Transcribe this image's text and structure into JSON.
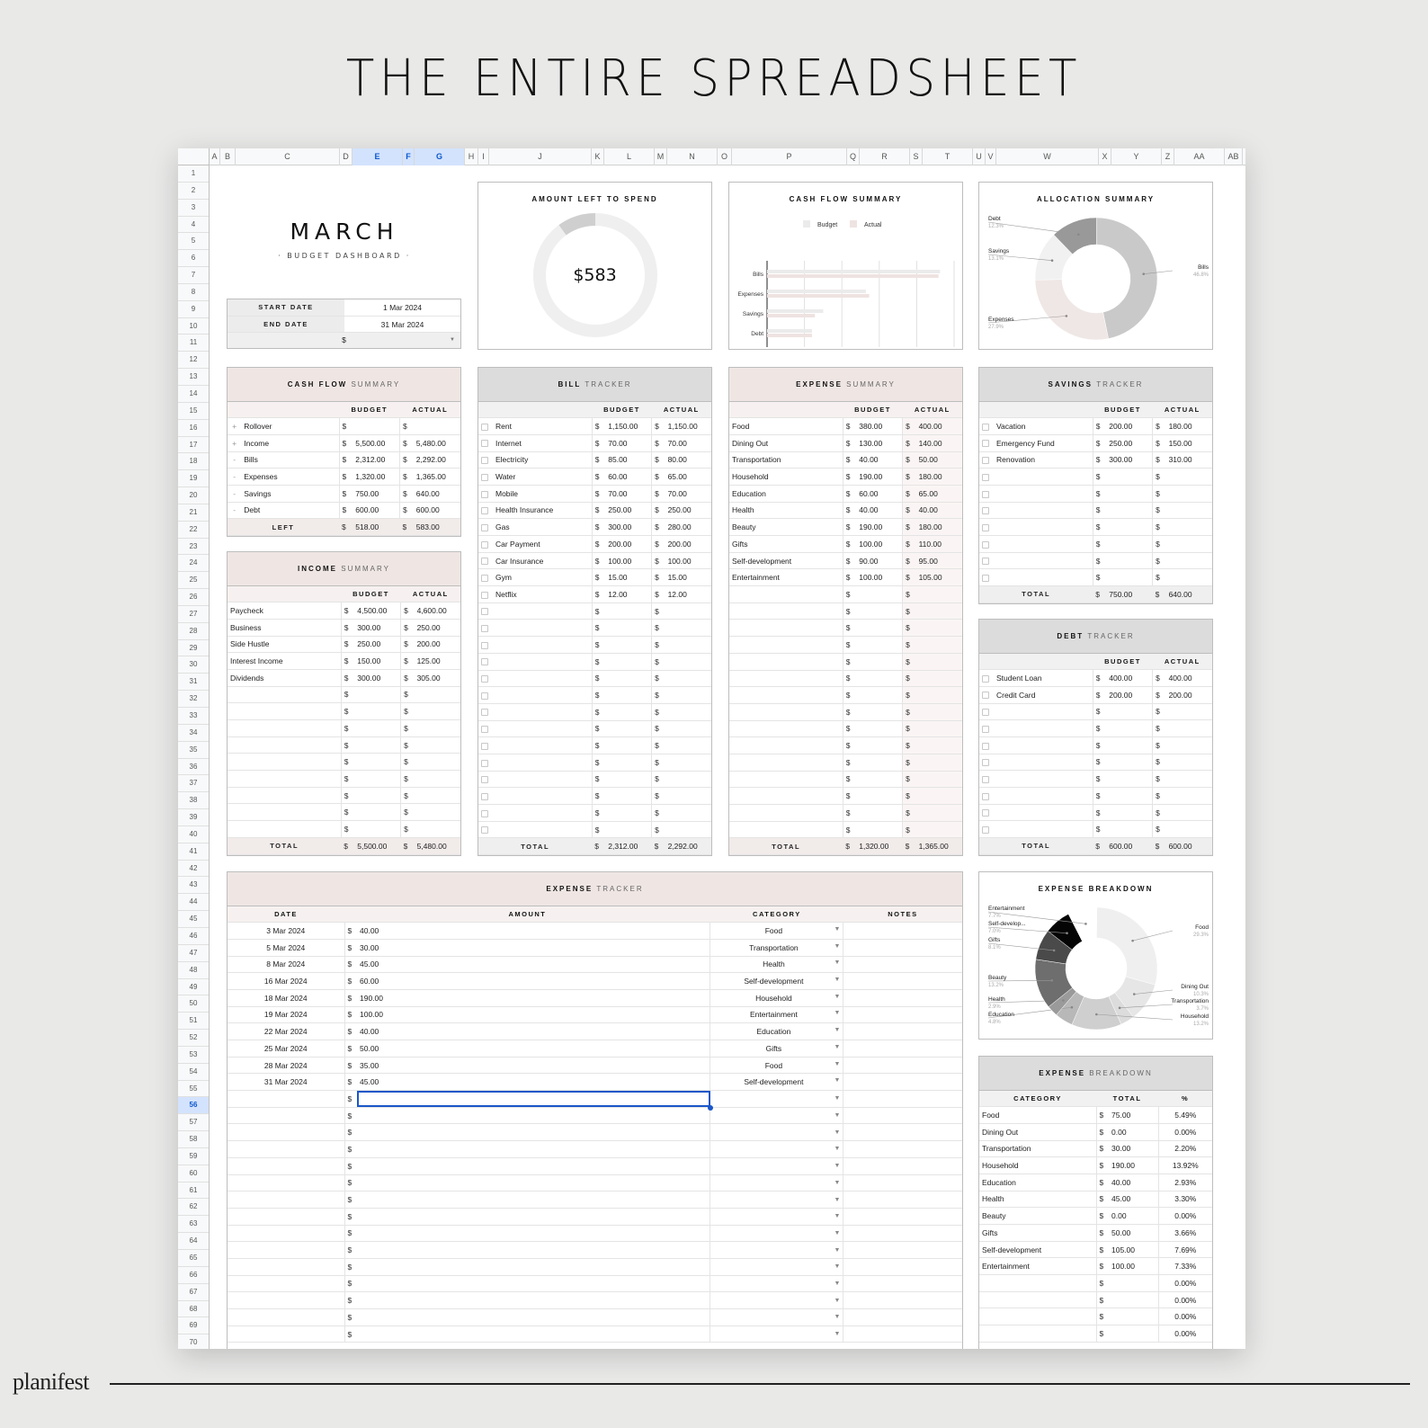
{
  "hero_title": "THE ENTIRE SPREADSHEET",
  "brand": "planifest",
  "columns": [
    "A",
    "B",
    "C",
    "D",
    "E",
    "F",
    "G",
    "H",
    "I",
    "J",
    "K",
    "L",
    "M",
    "N",
    "O",
    "P",
    "Q",
    "R",
    "S",
    "T",
    "U",
    "V",
    "W",
    "X",
    "Y",
    "Z",
    "AA",
    "AB"
  ],
  "selected_columns": [
    "E",
    "F",
    "G"
  ],
  "selected_row": 56,
  "dashboard": {
    "month": "MARCH",
    "subtitle": "· BUDGET DASHBOARD ·",
    "start_date_label": "START DATE",
    "start_date": "1 Mar 2024",
    "end_date_label": "END DATE",
    "end_date": "31 Mar 2024",
    "currency": "$"
  },
  "amount_left": {
    "title": "AMOUNT LEFT TO SPEND",
    "value": "$583",
    "fraction_spent_shown": 0.1
  },
  "chart_data": [
    {
      "type": "bar",
      "title": "CASH FLOW SUMMARY",
      "orientation": "horizontal",
      "categories": [
        "Bills",
        "Expenses",
        "Savings",
        "Debt"
      ],
      "series": [
        {
          "name": "Budget",
          "values": [
            2312,
            1320,
            750,
            600
          ],
          "color": "#ebebeb"
        },
        {
          "name": "Actual",
          "values": [
            2292,
            1365,
            640,
            600
          ],
          "color": "#eee3e1"
        }
      ],
      "xlim": [
        0,
        2500
      ],
      "grid": true,
      "legend": "top"
    },
    {
      "type": "pie",
      "title": "ALLOCATION SUMMARY",
      "donut": true,
      "slices": [
        {
          "label": "Bills",
          "percent": 46.8,
          "color": "#c9c9c9"
        },
        {
          "label": "Expenses",
          "percent": 27.9,
          "color": "#efe7e5"
        },
        {
          "label": "Savings",
          "percent": 13.1,
          "color": "#f1f1f1"
        },
        {
          "label": "Debt",
          "percent": 12.3,
          "color": "#999999"
        }
      ]
    },
    {
      "type": "pie",
      "title": "EXPENSE BREAKDOWN",
      "donut": true,
      "slices": [
        {
          "label": "Food",
          "percent": 29.3,
          "color": "#efefef"
        },
        {
          "label": "Dining Out",
          "percent": 10.3,
          "color": "#e6e6e6"
        },
        {
          "label": "Transportation",
          "percent": 3.7,
          "color": "#dcdcdc"
        },
        {
          "label": "Household",
          "percent": 13.2,
          "color": "#cfcfcf"
        },
        {
          "label": "Education",
          "percent": 4.8,
          "color": "#b8b8b8"
        },
        {
          "label": "Health",
          "percent": 2.9,
          "color": "#9a9a9a"
        },
        {
          "label": "Beauty",
          "percent": 13.2,
          "color": "#6e6e6e"
        },
        {
          "label": "Gifts",
          "percent": 8.1,
          "color": "#4a4a4a"
        },
        {
          "label": "Self-develop...",
          "percent": 7.0,
          "color": "#050505"
        },
        {
          "label": "Entertainment",
          "percent": 7.7,
          "color": "#ffffff"
        }
      ]
    }
  ],
  "cash_flow": {
    "title_bold": "CASH FLOW",
    "title_light": "SUMMARY",
    "headers": [
      "BUDGET",
      "ACTUAL"
    ],
    "rows": [
      {
        "sign": "+",
        "label": "Rollover",
        "budget": "",
        "actual": ""
      },
      {
        "sign": "+",
        "label": "Income",
        "budget": "5,500.00",
        "actual": "5,480.00"
      },
      {
        "sign": "-",
        "label": "Bills",
        "budget": "2,312.00",
        "actual": "2,292.00"
      },
      {
        "sign": "-",
        "label": "Expenses",
        "budget": "1,320.00",
        "actual": "1,365.00"
      },
      {
        "sign": "-",
        "label": "Savings",
        "budget": "750.00",
        "actual": "640.00"
      },
      {
        "sign": "-",
        "label": "Debt",
        "budget": "600.00",
        "actual": "600.00"
      }
    ],
    "footer_label": "LEFT",
    "footer_budget": "518.00",
    "footer_actual": "583.00"
  },
  "income": {
    "title_bold": "INCOME",
    "title_light": "SUMMARY",
    "headers": [
      "BUDGET",
      "ACTUAL"
    ],
    "rows": [
      {
        "label": "Paycheck",
        "budget": "4,500.00",
        "actual": "4,600.00"
      },
      {
        "label": "Business",
        "budget": "300.00",
        "actual": "250.00"
      },
      {
        "label": "Side Hustle",
        "budget": "250.00",
        "actual": "200.00"
      },
      {
        "label": "Interest Income",
        "budget": "150.00",
        "actual": "125.00"
      },
      {
        "label": "Dividends",
        "budget": "300.00",
        "actual": "305.00"
      },
      {
        "label": "",
        "budget": "",
        "actual": ""
      },
      {
        "label": "",
        "budget": "",
        "actual": ""
      },
      {
        "label": "",
        "budget": "",
        "actual": ""
      },
      {
        "label": "",
        "budget": "",
        "actual": ""
      },
      {
        "label": "",
        "budget": "",
        "actual": ""
      },
      {
        "label": "",
        "budget": "",
        "actual": ""
      },
      {
        "label": "",
        "budget": "",
        "actual": ""
      },
      {
        "label": "",
        "budget": "",
        "actual": ""
      },
      {
        "label": "",
        "budget": "",
        "actual": ""
      }
    ],
    "footer_label": "TOTAL",
    "footer_budget": "5,500.00",
    "footer_actual": "5,480.00"
  },
  "bills": {
    "title_bold": "BILL",
    "title_light": "TRACKER",
    "headers": [
      "BUDGET",
      "ACTUAL"
    ],
    "rows": [
      {
        "label": "Rent",
        "budget": "1,150.00",
        "actual": "1,150.00"
      },
      {
        "label": "Internet",
        "budget": "70.00",
        "actual": "70.00"
      },
      {
        "label": "Electricity",
        "budget": "85.00",
        "actual": "80.00"
      },
      {
        "label": "Water",
        "budget": "60.00",
        "actual": "65.00"
      },
      {
        "label": "Mobile",
        "budget": "70.00",
        "actual": "70.00"
      },
      {
        "label": "Health Insurance",
        "budget": "250.00",
        "actual": "250.00"
      },
      {
        "label": "Gas",
        "budget": "300.00",
        "actual": "280.00"
      },
      {
        "label": "Car Payment",
        "budget": "200.00",
        "actual": "200.00"
      },
      {
        "label": "Car Insurance",
        "budget": "100.00",
        "actual": "100.00"
      },
      {
        "label": "Gym",
        "budget": "15.00",
        "actual": "15.00"
      },
      {
        "label": "Netflix",
        "budget": "12.00",
        "actual": "12.00"
      },
      {
        "label": "",
        "budget": "",
        "actual": ""
      },
      {
        "label": "",
        "budget": "",
        "actual": ""
      },
      {
        "label": "",
        "budget": "",
        "actual": ""
      },
      {
        "label": "",
        "budget": "",
        "actual": ""
      },
      {
        "label": "",
        "budget": "",
        "actual": ""
      },
      {
        "label": "",
        "budget": "",
        "actual": ""
      },
      {
        "label": "",
        "budget": "",
        "actual": ""
      },
      {
        "label": "",
        "budget": "",
        "actual": ""
      },
      {
        "label": "",
        "budget": "",
        "actual": ""
      },
      {
        "label": "",
        "budget": "",
        "actual": ""
      },
      {
        "label": "",
        "budget": "",
        "actual": ""
      },
      {
        "label": "",
        "budget": "",
        "actual": ""
      },
      {
        "label": "",
        "budget": "",
        "actual": ""
      },
      {
        "label": "",
        "budget": "",
        "actual": ""
      }
    ],
    "footer_label": "TOTAL",
    "footer_budget": "2,312.00",
    "footer_actual": "2,292.00"
  },
  "expense_summary": {
    "title_bold": "EXPENSE",
    "title_light": "SUMMARY",
    "headers": [
      "BUDGET",
      "ACTUAL"
    ],
    "rows": [
      {
        "label": "Food",
        "budget": "380.00",
        "actual": "400.00"
      },
      {
        "label": "Dining Out",
        "budget": "130.00",
        "actual": "140.00"
      },
      {
        "label": "Transportation",
        "budget": "40.00",
        "actual": "50.00"
      },
      {
        "label": "Household",
        "budget": "190.00",
        "actual": "180.00"
      },
      {
        "label": "Education",
        "budget": "60.00",
        "actual": "65.00"
      },
      {
        "label": "Health",
        "budget": "40.00",
        "actual": "40.00"
      },
      {
        "label": "Beauty",
        "budget": "190.00",
        "actual": "180.00"
      },
      {
        "label": "Gifts",
        "budget": "100.00",
        "actual": "110.00"
      },
      {
        "label": "Self-development",
        "budget": "90.00",
        "actual": "95.00"
      },
      {
        "label": "Entertainment",
        "budget": "100.00",
        "actual": "105.00"
      },
      {
        "label": "",
        "budget": "",
        "actual": ""
      },
      {
        "label": "",
        "budget": "",
        "actual": ""
      },
      {
        "label": "",
        "budget": "",
        "actual": ""
      },
      {
        "label": "",
        "budget": "",
        "actual": ""
      },
      {
        "label": "",
        "budget": "",
        "actual": ""
      },
      {
        "label": "",
        "budget": "",
        "actual": ""
      },
      {
        "label": "",
        "budget": "",
        "actual": ""
      },
      {
        "label": "",
        "budget": "",
        "actual": ""
      },
      {
        "label": "",
        "budget": "",
        "actual": ""
      },
      {
        "label": "",
        "budget": "",
        "actual": ""
      },
      {
        "label": "",
        "budget": "",
        "actual": ""
      },
      {
        "label": "",
        "budget": "",
        "actual": ""
      },
      {
        "label": "",
        "budget": "",
        "actual": ""
      },
      {
        "label": "",
        "budget": "",
        "actual": ""
      },
      {
        "label": "",
        "budget": "",
        "actual": ""
      }
    ],
    "footer_label": "TOTAL",
    "footer_budget": "1,320.00",
    "footer_actual": "1,365.00"
  },
  "savings": {
    "title_bold": "SAVINGS",
    "title_light": "TRACKER",
    "headers": [
      "BUDGET",
      "ACTUAL"
    ],
    "rows": [
      {
        "label": "Vacation",
        "budget": "200.00",
        "actual": "180.00"
      },
      {
        "label": "Emergency Fund",
        "budget": "250.00",
        "actual": "150.00"
      },
      {
        "label": "Renovation",
        "budget": "300.00",
        "actual": "310.00"
      },
      {
        "label": "",
        "budget": "",
        "actual": ""
      },
      {
        "label": "",
        "budget": "",
        "actual": ""
      },
      {
        "label": "",
        "budget": "",
        "actual": ""
      },
      {
        "label": "",
        "budget": "",
        "actual": ""
      },
      {
        "label": "",
        "budget": "",
        "actual": ""
      },
      {
        "label": "",
        "budget": "",
        "actual": ""
      },
      {
        "label": "",
        "budget": "",
        "actual": ""
      }
    ],
    "footer_label": "TOTAL",
    "footer_budget": "750.00",
    "footer_actual": "640.00"
  },
  "debt": {
    "title_bold": "DEBT",
    "title_light": "TRACKER",
    "headers": [
      "BUDGET",
      "ACTUAL"
    ],
    "rows": [
      {
        "label": "Student Loan",
        "budget": "400.00",
        "actual": "400.00"
      },
      {
        "label": "Credit Card",
        "budget": "200.00",
        "actual": "200.00"
      },
      {
        "label": "",
        "budget": "",
        "actual": ""
      },
      {
        "label": "",
        "budget": "",
        "actual": ""
      },
      {
        "label": "",
        "budget": "",
        "actual": ""
      },
      {
        "label": "",
        "budget": "",
        "actual": ""
      },
      {
        "label": "",
        "budget": "",
        "actual": ""
      },
      {
        "label": "",
        "budget": "",
        "actual": ""
      },
      {
        "label": "",
        "budget": "",
        "actual": ""
      },
      {
        "label": "",
        "budget": "",
        "actual": ""
      }
    ],
    "footer_label": "TOTAL",
    "footer_budget": "600.00",
    "footer_actual": "600.00"
  },
  "expense_tracker": {
    "title_bold": "EXPENSE",
    "title_light": "TRACKER",
    "headers": [
      "DATE",
      "AMOUNT",
      "CATEGORY",
      "NOTES"
    ],
    "rows": [
      {
        "date": "3 Mar 2024",
        "amount": "40.00",
        "category": "Food",
        "notes": ""
      },
      {
        "date": "5 Mar 2024",
        "amount": "30.00",
        "category": "Transportation",
        "notes": ""
      },
      {
        "date": "8 Mar 2024",
        "amount": "45.00",
        "category": "Health",
        "notes": ""
      },
      {
        "date": "16 Mar 2024",
        "amount": "60.00",
        "category": "Self-development",
        "notes": ""
      },
      {
        "date": "18 Mar 2024",
        "amount": "190.00",
        "category": "Household",
        "notes": ""
      },
      {
        "date": "19 Mar 2024",
        "amount": "100.00",
        "category": "Entertainment",
        "notes": ""
      },
      {
        "date": "22 Mar 2024",
        "amount": "40.00",
        "category": "Education",
        "notes": ""
      },
      {
        "date": "25 Mar 2024",
        "amount": "50.00",
        "category": "Gifts",
        "notes": ""
      },
      {
        "date": "28 Mar 2024",
        "amount": "35.00",
        "category": "Food",
        "notes": ""
      },
      {
        "date": "31 Mar 2024",
        "amount": "45.00",
        "category": "Self-development",
        "notes": ""
      },
      {
        "date": "",
        "amount": "",
        "category": "",
        "notes": ""
      },
      {
        "date": "",
        "amount": "",
        "category": "",
        "notes": ""
      },
      {
        "date": "",
        "amount": "",
        "category": "",
        "notes": ""
      },
      {
        "date": "",
        "amount": "",
        "category": "",
        "notes": ""
      },
      {
        "date": "",
        "amount": "",
        "category": "",
        "notes": ""
      },
      {
        "date": "",
        "amount": "",
        "category": "",
        "notes": ""
      },
      {
        "date": "",
        "amount": "",
        "category": "",
        "notes": ""
      },
      {
        "date": "",
        "amount": "",
        "category": "",
        "notes": ""
      },
      {
        "date": "",
        "amount": "",
        "category": "",
        "notes": ""
      },
      {
        "date": "",
        "amount": "",
        "category": "",
        "notes": ""
      },
      {
        "date": "",
        "amount": "",
        "category": "",
        "notes": ""
      },
      {
        "date": "",
        "amount": "",
        "category": "",
        "notes": ""
      },
      {
        "date": "",
        "amount": "",
        "category": "",
        "notes": ""
      },
      {
        "date": "",
        "amount": "",
        "category": "",
        "notes": ""
      },
      {
        "date": "",
        "amount": "",
        "category": "",
        "notes": ""
      }
    ]
  },
  "expense_breakdown_table": {
    "title_bold": "EXPENSE",
    "title_light": "BREAKDOWN",
    "headers": [
      "CATEGORY",
      "TOTAL",
      "%"
    ],
    "rows": [
      {
        "category": "Food",
        "total": "75.00",
        "pct": "5.49%"
      },
      {
        "category": "Dining Out",
        "total": "0.00",
        "pct": "0.00%"
      },
      {
        "category": "Transportation",
        "total": "30.00",
        "pct": "2.20%"
      },
      {
        "category": "Household",
        "total": "190.00",
        "pct": "13.92%"
      },
      {
        "category": "Education",
        "total": "40.00",
        "pct": "2.93%"
      },
      {
        "category": "Health",
        "total": "45.00",
        "pct": "3.30%"
      },
      {
        "category": "Beauty",
        "total": "0.00",
        "pct": "0.00%"
      },
      {
        "category": "Gifts",
        "total": "50.00",
        "pct": "3.66%"
      },
      {
        "category": "Self-development",
        "total": "105.00",
        "pct": "7.69%"
      },
      {
        "category": "Entertainment",
        "total": "100.00",
        "pct": "7.33%"
      },
      {
        "category": "",
        "total": "",
        "pct": "0.00%"
      },
      {
        "category": "",
        "total": "",
        "pct": "0.00%"
      },
      {
        "category": "",
        "total": "",
        "pct": "0.00%"
      },
      {
        "category": "",
        "total": "",
        "pct": "0.00%"
      }
    ]
  }
}
